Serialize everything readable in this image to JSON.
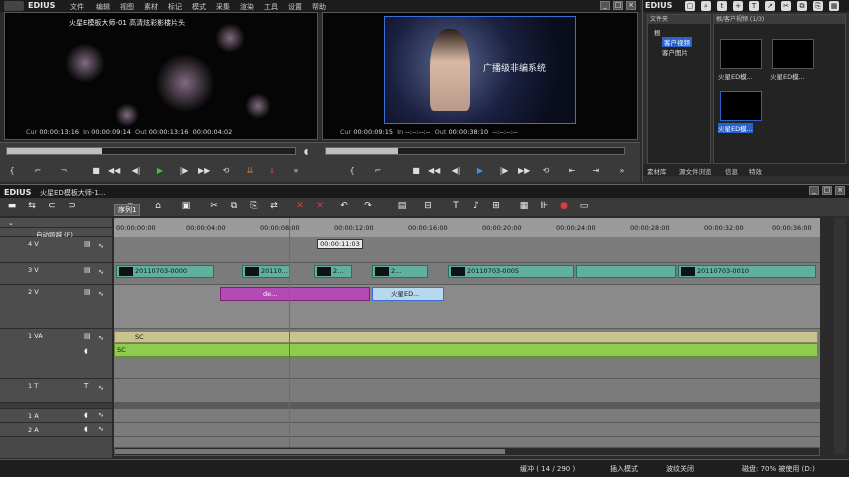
{
  "app": {
    "brand": "EDIUS"
  },
  "menu": [
    "文件",
    "编辑",
    "视图",
    "素材",
    "标记",
    "模式",
    "采集",
    "渲染",
    "工具",
    "设置",
    "帮助"
  ],
  "player": {
    "title": "火星E模板大师-01 高清炫彩影楼片头",
    "source_cur": "00:00:13:16",
    "source_in": "00:00:09:14",
    "source_out": "00:00:13:16",
    "source_dur": "00:00:04:02",
    "rec_cur": "00:00:09:15",
    "rec_in": "--:--:--:--",
    "rec_out": "00:00:38:10",
    "rec_dur": "--:--:--:--",
    "cur_label": "Cur",
    "in_label": "In",
    "out_label": "Out",
    "preview_text": "广播级非编系统",
    "source_progress": 0.33,
    "rec_progress": 0.24
  },
  "bin": {
    "brand": "EDIUS",
    "folder_head": "文件夹",
    "clip_head": "根/客户视频 (1/3)",
    "tree": [
      "根",
      "客户视频",
      "客户图片"
    ],
    "clips": [
      {
        "label": "火星ED模..."
      },
      {
        "label": "火星ED模..."
      },
      {
        "label": "火星ED模..."
      }
    ],
    "tabs": [
      "素材库",
      "源文件浏览",
      "信息",
      "特效"
    ]
  },
  "timeline": {
    "brand": "EDIUS",
    "project": "火星ED模板大师-1...",
    "sequence_tab": "序列1",
    "ruler": [
      "00:00:00:00",
      "00:00:04:00",
      "00:00:08:00",
      "00:00:12:00",
      "00:00:16:00",
      "00:00:20:00",
      "00:00:24:00",
      "00:00:28:00",
      "00:00:32:00",
      "00:00:36:00"
    ],
    "cursor_tc": "00:00:11:03",
    "track_headers": [
      {
        "name": "自动跨越 (F)"
      },
      {
        "name": "4 V"
      },
      {
        "name": "3 V"
      },
      {
        "name": "2 V"
      },
      {
        "name": "1 VA"
      },
      {
        "name": "1 T"
      },
      {
        "name": "1 A"
      },
      {
        "name": "2 A"
      }
    ],
    "clips_3v": [
      {
        "label": "20110703-0000"
      },
      {
        "label": "20110..."
      },
      {
        "label": "2..."
      },
      {
        "label": "2..."
      },
      {
        "label": "20110703-0005"
      },
      {
        "label": "20110703-0010"
      }
    ],
    "clip_2v_label": "de...",
    "clip_2v_title": "火星ED...",
    "audio_label": "SC",
    "audio_label2": "SC"
  },
  "status": {
    "buffer": "缓冲 ( 14 / 290 )",
    "mode": "插入模式",
    "ripple": "波纹关闭",
    "disk": "磁盘: 70% 被使用 (D:)"
  }
}
